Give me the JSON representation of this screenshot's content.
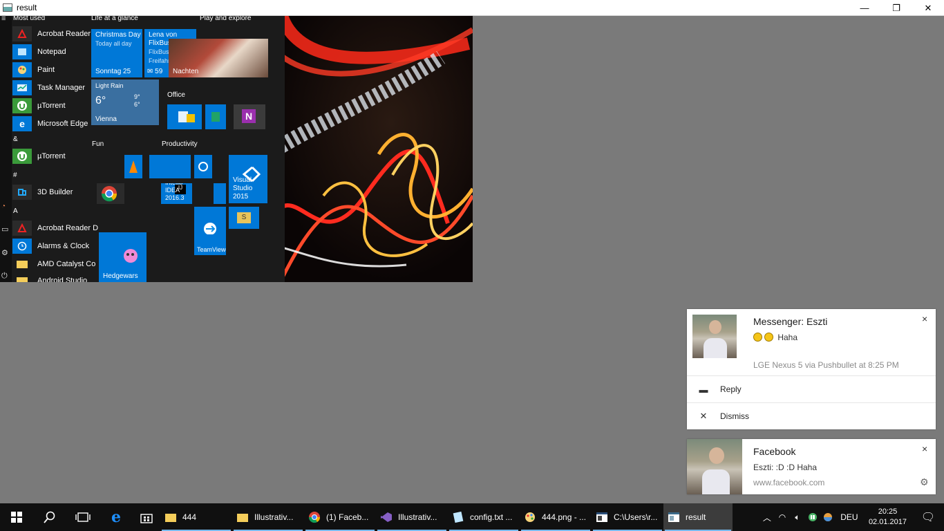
{
  "window": {
    "title": "result",
    "minimize": "—",
    "restore": "❐",
    "close": "✕"
  },
  "startmenu": {
    "rail_label": "≡",
    "groups": {
      "most_used": "Most used",
      "amp": "&",
      "hash": "#",
      "a": "A"
    },
    "apps": [
      {
        "label": "Acrobat Reader DC",
        "icon": "acrobat-icon"
      },
      {
        "label": "Notepad",
        "icon": "notepad-icon"
      },
      {
        "label": "Paint",
        "icon": "paint-icon"
      },
      {
        "label": "Task Manager",
        "icon": "task-manager-icon"
      },
      {
        "label": "µTorrent",
        "icon": "utorrent-icon"
      },
      {
        "label": "Microsoft Edge",
        "icon": "edge-icon"
      },
      {
        "label": "µTorrent",
        "icon": "utorrent-icon"
      },
      {
        "label": "3D Builder",
        "icon": "3d-builder-icon"
      },
      {
        "label": "Acrobat Reader DC",
        "icon": "acrobat-icon"
      },
      {
        "label": "Alarms & Clock",
        "icon": "alarm-icon"
      },
      {
        "label": "AMD Catalyst Co",
        "icon": "folder-icon"
      },
      {
        "label": "Android Studio",
        "icon": "folder-icon"
      }
    ],
    "tile_groups": {
      "life": "Life at a glance",
      "play": "Play and explore",
      "office": "Office",
      "fun": "Fun",
      "productivity": "Productivity"
    },
    "tiles": {
      "calendar": {
        "title": "Christmas Day",
        "sub": "Today all day",
        "date": "Sonntag 25"
      },
      "mail": {
        "title": "Lena von FlixBus",
        "sub1": "FlixBus App:",
        "sub2": "Freifahrt",
        "count": "59"
      },
      "photos": {
        "label": "Nachten"
      },
      "weather": {
        "cond": "Light Rain",
        "temp": "6°",
        "hi": "9°",
        "lo": "6°",
        "city": "Vienna"
      },
      "intellij": {
        "label": "IntelliJ IDEA",
        "sub": "2016.3"
      },
      "visualstudio": {
        "label": "Visual Studio",
        "sub": "2015"
      },
      "teamviewer": {
        "label": "TeamViewer"
      },
      "hedgewars": {
        "label": "Hedgewars"
      },
      "onenote": {
        "label": "N"
      }
    }
  },
  "notifications": {
    "messenger": {
      "title": "Messenger: Eszti",
      "message": "Haha",
      "meta": "LGE Nexus 5 via Pushbullet at 8:25 PM",
      "close": "×",
      "reply": "Reply",
      "dismiss": "Dismiss"
    },
    "facebook": {
      "title": "Facebook",
      "message": "Eszti: :D :D Haha",
      "meta": "www.facebook.com",
      "close": "×"
    }
  },
  "taskbar": {
    "apps": [
      {
        "label": "444",
        "icon": "folder-icon"
      },
      {
        "label": "Illustrativ...",
        "icon": "folder-icon"
      },
      {
        "label": "(1) Faceb...",
        "icon": "chrome-icon"
      },
      {
        "label": "Illustrativ...",
        "icon": "visual-studio-icon"
      },
      {
        "label": "config.txt ...",
        "icon": "notepad-icon"
      },
      {
        "label": "444.png - ...",
        "icon": "paint-icon"
      },
      {
        "label": "C:\\Users\\r...",
        "icon": "console-icon"
      },
      {
        "label": "result",
        "icon": "window-icon"
      }
    ],
    "language": "DEU",
    "time": "20:25",
    "date": "02.01.2017"
  },
  "colors": {
    "accent": "#0078d7",
    "taskbar": "#101010",
    "desktop": "#7a7a7a"
  }
}
